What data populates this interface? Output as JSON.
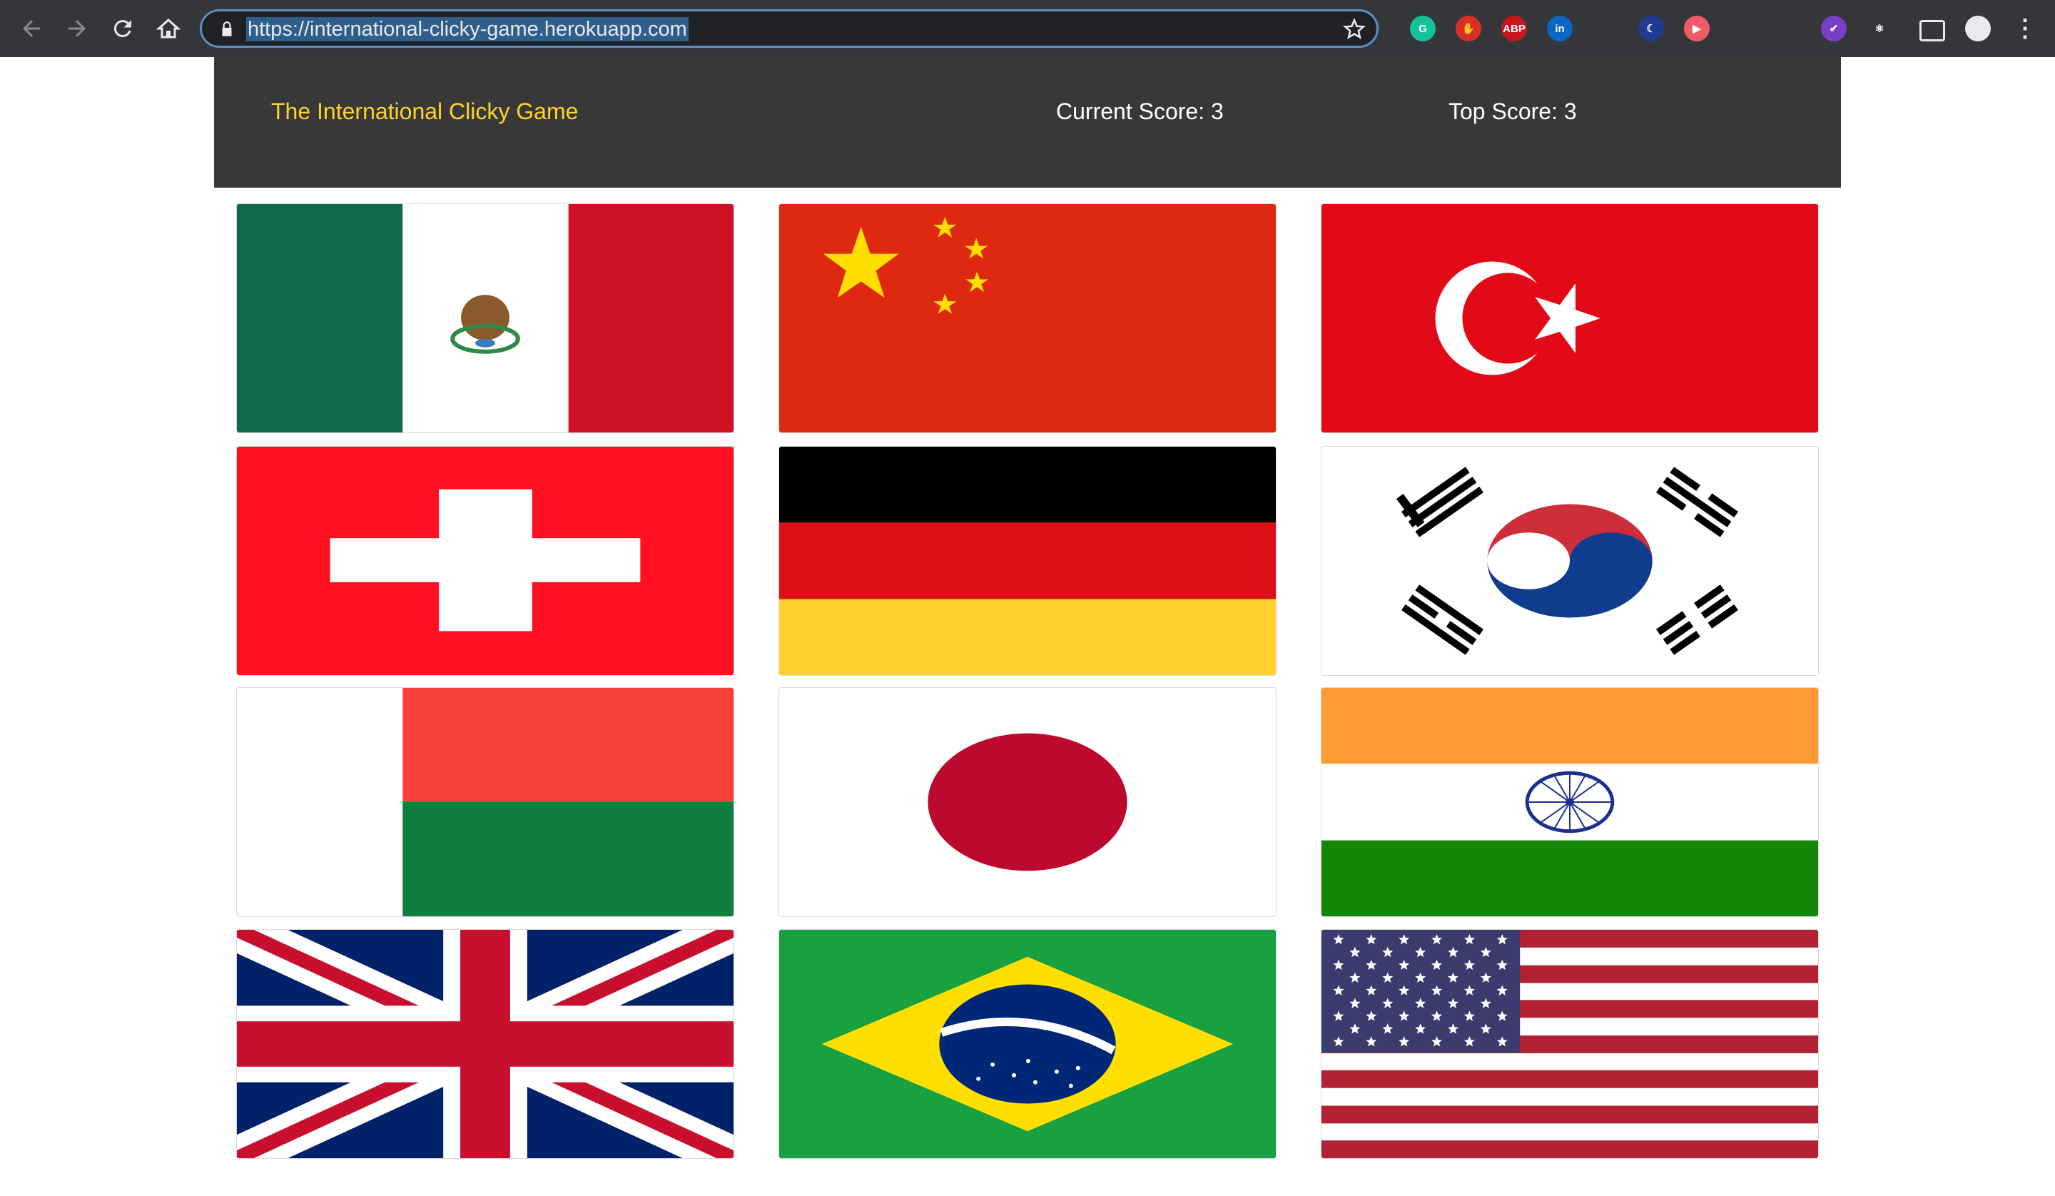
{
  "browser": {
    "url": "https://international-clicky-game.herokuapp.com",
    "icons": [
      "back-icon",
      "forward-icon",
      "reload-icon",
      "home-icon",
      "lock-icon",
      "bookmark-star-icon"
    ],
    "extensions": [
      {
        "name": "grammarly-icon",
        "color": "#15c39a",
        "label": "G"
      },
      {
        "name": "hand-stop-icon",
        "color": "#d93025",
        "label": "✋"
      },
      {
        "name": "adblock-plus-icon",
        "color": "#c7161d",
        "label": "ABP"
      },
      {
        "name": "linkedin-icon",
        "color": "#0a66c2",
        "label": "in"
      },
      {
        "name": "rainbow-icon",
        "color": "#35363a",
        "label": ""
      },
      {
        "name": "moon-icon",
        "color": "#203a8f",
        "label": "☾"
      },
      {
        "name": "video-icon",
        "color": "#ef5c68",
        "label": "▶"
      },
      {
        "name": "eyedropper-icon",
        "color": "#35363a",
        "label": ""
      },
      {
        "name": "cloud-icon",
        "color": "#35363a",
        "label": ""
      },
      {
        "name": "check-icon",
        "color": "#7a3fc6",
        "label": "✔"
      },
      {
        "name": "react-icon",
        "color": "#35363a",
        "label": "⚛"
      },
      {
        "name": "cast-icon",
        "color": "#35363a",
        "label": ""
      },
      {
        "name": "profile-avatar-icon",
        "color": "#dddddd",
        "label": ""
      },
      {
        "name": "menu-kebab-icon",
        "color": "#35363a",
        "label": "⋮"
      }
    ]
  },
  "header": {
    "title": "The International Clicky Game",
    "current_score": "Current Score: 3",
    "top_score": "Top Score: 3"
  },
  "colors": {
    "brand": "#ffd22b",
    "navbar": "#383838"
  },
  "flags": [
    {
      "country": "Mexico"
    },
    {
      "country": "China"
    },
    {
      "country": "Turkey"
    },
    {
      "country": "Switzerland"
    },
    {
      "country": "Germany"
    },
    {
      "country": "South Korea"
    },
    {
      "country": "Madagascar"
    },
    {
      "country": "Japan"
    },
    {
      "country": "India"
    },
    {
      "country": "United Kingdom"
    },
    {
      "country": "Brazil"
    },
    {
      "country": "United States"
    }
  ]
}
